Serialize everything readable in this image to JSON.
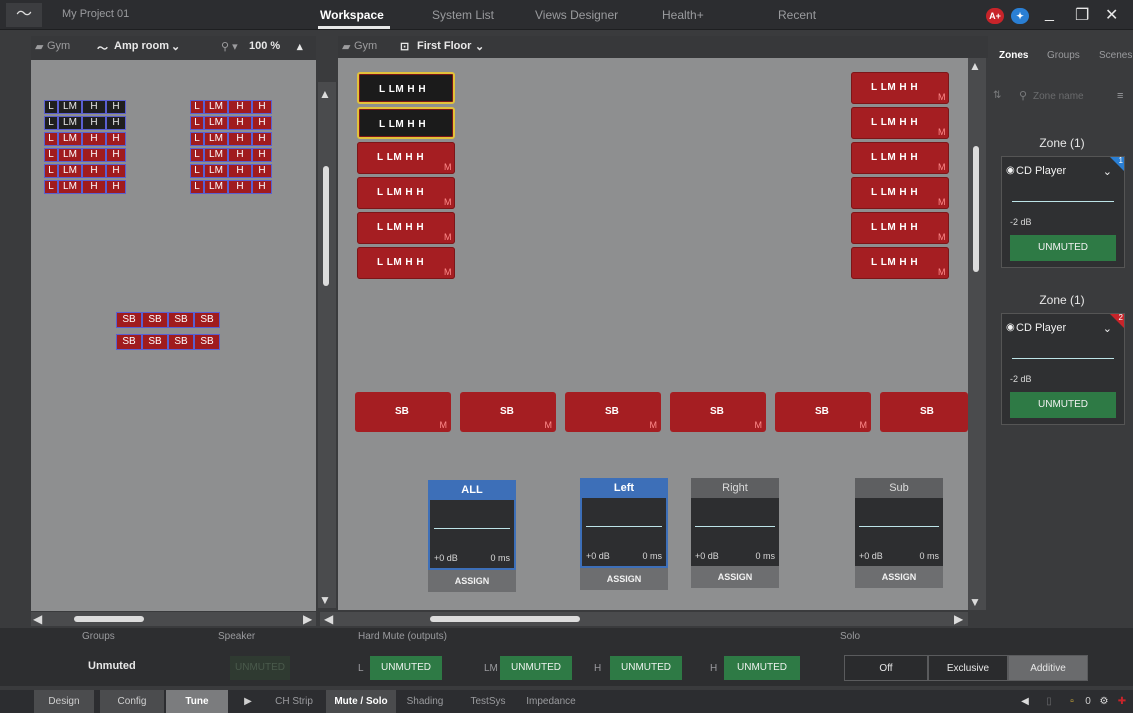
{
  "titlebar": {
    "project": "My Project 01",
    "tabs": [
      "Workspace",
      "System List",
      "Views Designer",
      "Health+",
      "Recent"
    ],
    "active_tab": "Workspace",
    "badge_a": "A+",
    "controls": {
      "minimize": "_",
      "maximize": "❐",
      "close": "✕"
    }
  },
  "left_pane": {
    "folder": "Gym",
    "room": "Amp room",
    "zoom": "100 %",
    "grid_rows": [
      [
        "L",
        "LM",
        "H",
        "H"
      ],
      [
        "L",
        "LM",
        "H",
        "H"
      ],
      [
        "L",
        "LM",
        "H",
        "H"
      ],
      [
        "L",
        "LM",
        "H",
        "H"
      ],
      [
        "L",
        "LM",
        "H",
        "H"
      ],
      [
        "L",
        "LM",
        "H",
        "H"
      ]
    ],
    "sub_rows": [
      [
        "SB",
        "SB",
        "SB",
        "SB"
      ],
      [
        "SB",
        "SB",
        "SB",
        "SB"
      ]
    ],
    "groups_label": "Groups",
    "speaker_label": "Speaker",
    "groups_state": "Unmuted",
    "speaker_state": "UNMUTED"
  },
  "mid_pane": {
    "folder": "Gym",
    "floor": "First Floor",
    "speaker_label": "L LM H H",
    "mute_marker": "M",
    "sb_label": "SB",
    "groups": [
      {
        "name": "ALL",
        "db": "+0 dB",
        "ms": "0 ms",
        "assign": "ASSIGN"
      },
      {
        "name": "Left",
        "db": "+0 dB",
        "ms": "0 ms",
        "assign": "ASSIGN"
      },
      {
        "name": "Right",
        "db": "+0 dB",
        "ms": "0 ms",
        "assign": "ASSIGN"
      },
      {
        "name": "Sub",
        "db": "+0 dB",
        "ms": "0 ms",
        "assign": "ASSIGN"
      }
    ]
  },
  "right_panel": {
    "tabs": [
      "Zones",
      "Groups",
      "Scenes"
    ],
    "search_placeholder": "Zone name",
    "zones": [
      {
        "title": "Zone (1)",
        "source": "CD Player",
        "level": "-2 dB",
        "state": "UNMUTED",
        "num": "1",
        "color": "#2a7fd4"
      },
      {
        "title": "Zone (1)",
        "source": "CD Player",
        "level": "-2 dB",
        "state": "UNMUTED",
        "num": "2",
        "color": "#c8242a"
      }
    ]
  },
  "hard_mute": {
    "label": "Hard Mute (outputs)",
    "channels": [
      {
        "ch": "L",
        "state": "UNMUTED"
      },
      {
        "ch": "LM",
        "state": "UNMUTED"
      },
      {
        "ch": "H",
        "state": "UNMUTED"
      },
      {
        "ch": "H",
        "state": "UNMUTED"
      }
    ]
  },
  "solo": {
    "label": "Solo",
    "options": [
      "Off",
      "Exclusive",
      "Additive"
    ],
    "selected": "Additive"
  },
  "footer": {
    "modes": [
      "Design",
      "Config",
      "Tune"
    ],
    "active_mode": "Tune",
    "tabs": [
      "CH Strip",
      "Mute / Solo",
      "Shading",
      "TestSys",
      "Impedance"
    ],
    "active_tab": "Mute / Solo",
    "counter": "0"
  }
}
